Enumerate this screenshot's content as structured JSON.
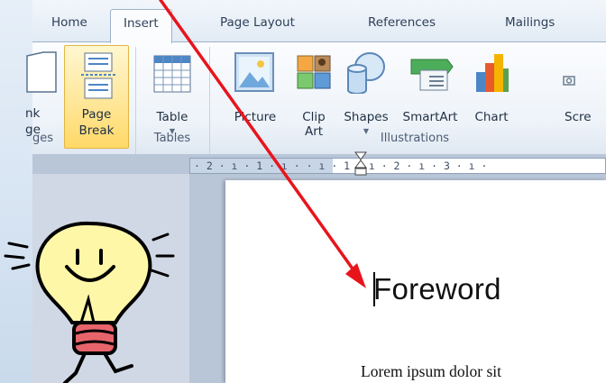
{
  "tabs": [
    {
      "label": "Home"
    },
    {
      "label": "Insert",
      "active": true
    },
    {
      "label": "Page Layout"
    },
    {
      "label": "References"
    },
    {
      "label": "Mailings"
    }
  ],
  "ribbon": {
    "pages_group": {
      "blank_page_label_1": "nk",
      "blank_page_label_2": "ge",
      "page_break_label_1": "Page",
      "page_break_label_2": "Break",
      "group_label": "ges"
    },
    "tables_group": {
      "table_label": "Table",
      "group_label": "Tables"
    },
    "illustrations_group": {
      "picture_label": "Picture",
      "clip_art_label_1": "Clip",
      "clip_art_label_2": "Art",
      "shapes_label": "Shapes",
      "smartart_label": "SmartArt",
      "chart_label": "Chart",
      "screenshot_label": "Scre",
      "group_label": "Illustrations"
    }
  },
  "ruler": {
    "text": "· 2 · ı · 1 · ı ·   · ı · 1 · ı · 2 · ı · 3 · ı ·"
  },
  "document": {
    "heading": "Foreword",
    "body": "Lorem ipsum dolor sit"
  },
  "colors": {
    "accent_highlight": "#ffd867",
    "arrow": "#e8141c"
  },
  "icons": [
    "page-break-icon",
    "table-icon",
    "picture-icon",
    "clip-art-icon",
    "shapes-icon",
    "smartart-icon",
    "chart-icon",
    "lightbulb-icon",
    "arrow-annotation"
  ]
}
